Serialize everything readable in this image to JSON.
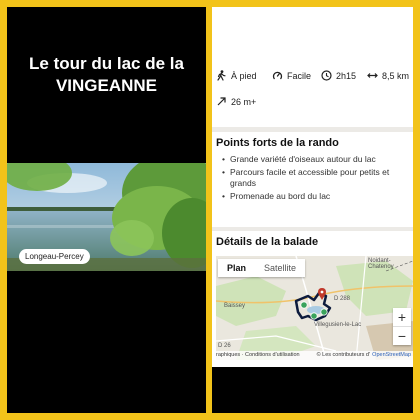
{
  "left_panel": {
    "title_line1": "Le tour du lac de la",
    "title_line2": "VINGEANNE",
    "photo_caption": "Longeau-Percey"
  },
  "stats": {
    "mode": {
      "label": "À pied",
      "icon": "walker-icon"
    },
    "difficulty": {
      "label": "Facile",
      "icon": "difficulty-icon"
    },
    "duration": {
      "label": "2h15",
      "icon": "clock-icon"
    },
    "distance": {
      "label": "8,5 km",
      "icon": "distance-arrows-icon"
    },
    "elevation": {
      "label": "26 m+",
      "icon": "elevation-arrow-icon"
    }
  },
  "highlights": {
    "title": "Points forts de la rando",
    "items": [
      "Grande variété d'oiseaux autour du lac",
      "Parcours facile et accessible pour petits et grands",
      "Promenade au bord du lac"
    ]
  },
  "details": {
    "title": "Détails de la balade"
  },
  "map": {
    "tabs": [
      "Plan",
      "Satellite"
    ],
    "active_tab": "Plan",
    "zoom_in": "+",
    "zoom_out": "−",
    "labels": {
      "top_right": "Noidant-Chatenoy",
      "left": "Baissey",
      "village": "Villegusien-le-Lac",
      "bottom_left": "D 26",
      "road": "D 288"
    },
    "attribution_left": "raphiques · Conditions d'utilisation",
    "attribution_mid": "© Les contributeurs d'",
    "attribution_link": "OpenStreetMap",
    "colors": {
      "route": "#0d1b3d",
      "marker": "#c0392b",
      "poi": "#3aa35c"
    }
  }
}
